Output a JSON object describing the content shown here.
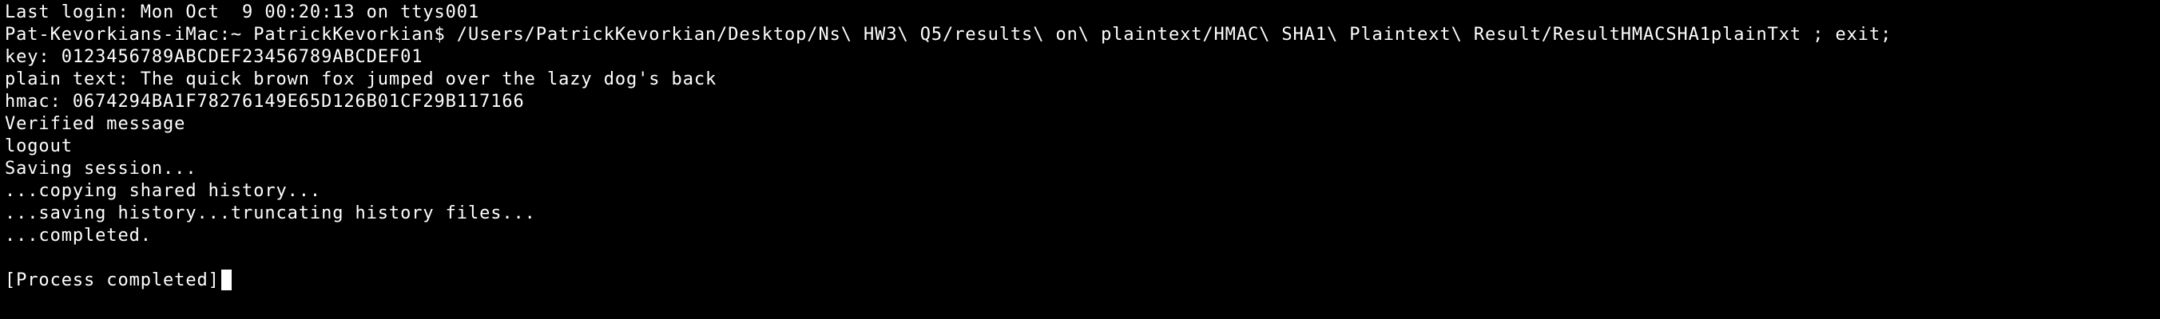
{
  "terminal": {
    "lines": [
      "Last login: Mon Oct  9 00:20:13 on ttys001",
      "Pat-Kevorkians-iMac:~ PatrickKevorkian$ /Users/PatrickKevorkian/Desktop/Ns\\ HW3\\ Q5/results\\ on\\ plaintext/HMAC\\ SHA1\\ Plaintext\\ Result/ResultHMACSHA1plainTxt ; exit;",
      "key: 0123456789ABCDEF23456789ABCDEF01",
      "plain text: The quick brown fox jumped over the lazy dog's back",
      "hmac: 0674294BA1F78276149E65D126B01CF29B117166",
      "Verified message",
      "logout",
      "Saving session...",
      "...copying shared history...",
      "...saving history...truncating history files...",
      "...completed.",
      "",
      "[Process completed]"
    ]
  },
  "colors": {
    "background": "#000000",
    "foreground": "#ffffff",
    "cursor": "#ffffff"
  }
}
